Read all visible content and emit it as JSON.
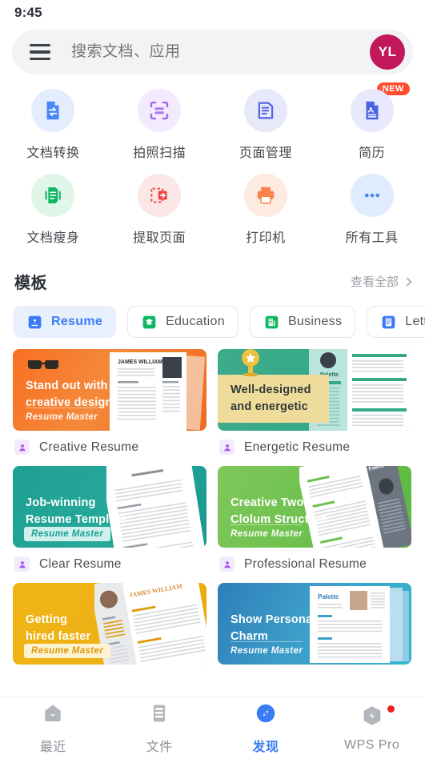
{
  "status": {
    "time": "9:45"
  },
  "search": {
    "menu_icon": "hamburger-menu-icon",
    "placeholder": "搜索文档、应用",
    "avatar_initials": "YL",
    "avatar_color": "#c2185b"
  },
  "tools": [
    {
      "label": "文档转换",
      "icon": "document-convert-icon",
      "bg": "#e4edfd",
      "fg": "#4a86f7",
      "badge": ""
    },
    {
      "label": "拍照扫描",
      "icon": "camera-scan-icon",
      "bg": "#f3eafe",
      "fg": "#a265f0",
      "badge": ""
    },
    {
      "label": "页面管理",
      "icon": "page-manage-icon",
      "bg": "#e7e9fb",
      "fg": "#5466e8",
      "badge": ""
    },
    {
      "label": "简历",
      "icon": "resume-icon",
      "bg": "#e8e9fc",
      "fg": "#4a63e8",
      "badge": "NEW"
    },
    {
      "label": "文档瘦身",
      "icon": "document-slim-icon",
      "bg": "#dff6e9",
      "fg": "#0fb763",
      "badge": ""
    },
    {
      "label": "提取页面",
      "icon": "extract-page-icon",
      "bg": "#fce7e7",
      "fg": "#ef4444",
      "badge": ""
    },
    {
      "label": "打印机",
      "icon": "printer-icon",
      "bg": "#fdeae0",
      "fg": "#f8834b",
      "badge": ""
    },
    {
      "label": "所有工具",
      "icon": "more-dots-icon",
      "bg": "#e0ebfd",
      "fg": "#4a86f7",
      "badge": ""
    }
  ],
  "templates_section": {
    "title": "模板",
    "more_label": "查看全部",
    "more_icon": "chevron-right-icon"
  },
  "chips": [
    {
      "label": "Resume",
      "icon": "resume-chip-icon",
      "color": "#3b7cf5",
      "active": true
    },
    {
      "label": "Education",
      "icon": "education-chip-icon",
      "color": "#0fb763",
      "active": false
    },
    {
      "label": "Business",
      "icon": "business-chip-icon",
      "color": "#0fb763",
      "active": false
    },
    {
      "label": "Letter",
      "icon": "letter-chip-icon",
      "color": "#3b7cf5",
      "active": false
    },
    {
      "label": "",
      "icon": "mail-chip-icon",
      "color": "#f5a623",
      "active": false
    }
  ],
  "cards": [
    {
      "name": "Creative Resume",
      "headline_line1": "Stand out with",
      "headline_line2": "creative design",
      "brand": "Resume Master",
      "art_bg": "linear-gradient(120deg,#f97022 0%,#f4893b 45%,#ef6a1e 100%)",
      "title_color": "#ffffff",
      "brand_color": "rgba(255,255,255,.92)",
      "brand_boxed": false,
      "decor": "glasses",
      "doc_name": "JAMES WILLIAM",
      "doc_style": "portrait-photo"
    },
    {
      "name": "Energetic Resume",
      "headline_line1": "Well-designed",
      "headline_line2": "and energetic",
      "brand": "Resume Master",
      "art_bg": "linear-gradient(120deg,#3cab8c 0%,#35a987 60%,#2f9e7e 100%)",
      "title_color": "#2f3a37",
      "brand_color": "rgba(255,255,255,.95)",
      "brand_boxed": false,
      "decor": "trophy",
      "doc_name": "Palette",
      "doc_style": "two-column-teal",
      "title_bg": "#f0dc9a"
    },
    {
      "name": "Clear Resume",
      "headline_line1": "Job-winning",
      "headline_line2": "Resume Template",
      "brand": "Resume Master",
      "art_bg": "linear-gradient(120deg,#1fa094 0%,#25a99a 55%,#17978d 100%)",
      "title_color": "#ffffff",
      "brand_color": "#1fa094",
      "brand_boxed": true,
      "brand_box_bg": "#cff0ec",
      "decor": "none",
      "doc_name": "",
      "doc_style": "tilted-white"
    },
    {
      "name": "Professional Resume",
      "headline_line1": "Creative Two",
      "headline_line2": "Clolum Structure",
      "brand": "Resume Master",
      "art_bg": "linear-gradient(120deg,#7ec85a 0%,#6dc04e 55%,#57b83f 100%)",
      "title_color": "#ffffff",
      "brand_color": "rgba(255,255,255,.95)",
      "brand_boxed": false,
      "decor": "none",
      "doc_name": "Palette",
      "doc_style": "tilted-gray"
    },
    {
      "name": "",
      "headline_line1": "Getting",
      "headline_line2": "hired faster",
      "brand": "Resume Master",
      "art_bg": "linear-gradient(120deg,#f0b415 0%,#eeb217 55%,#e9a50f 100%)",
      "title_color": "#ffffff",
      "brand_color": "#e09a0c",
      "brand_boxed": true,
      "brand_box_bg": "#fdf2d2",
      "decor": "none",
      "doc_name": "JAMES WILLIAM",
      "doc_style": "tilted-avatar"
    },
    {
      "name": "",
      "headline_line1": "Show Personal",
      "headline_line2": "Charm",
      "brand": "Resume Master",
      "art_bg": "linear-gradient(115deg,#2e7fba 0%,#3d9ec9 45%,#35b6cf 100%)",
      "title_color": "#ffffff",
      "brand_color": "rgba(255,255,255,.95)",
      "brand_boxed": false,
      "decor": "none",
      "doc_name": "Palette",
      "doc_style": "blue-stack"
    }
  ],
  "tabbar": [
    {
      "label": "最近",
      "icon": "recent-icon",
      "active": false,
      "badge": false
    },
    {
      "label": "文件",
      "icon": "files-icon",
      "active": false,
      "badge": false
    },
    {
      "label": "发现",
      "icon": "compass-icon",
      "active": true,
      "badge": false
    },
    {
      "label": "WPS Pro",
      "icon": "wps-pro-icon",
      "active": false,
      "badge": true
    }
  ],
  "colors": {
    "accent": "#3b7cf5",
    "badge_red": "#ff4d2e",
    "dot_red": "#f01f1f"
  }
}
